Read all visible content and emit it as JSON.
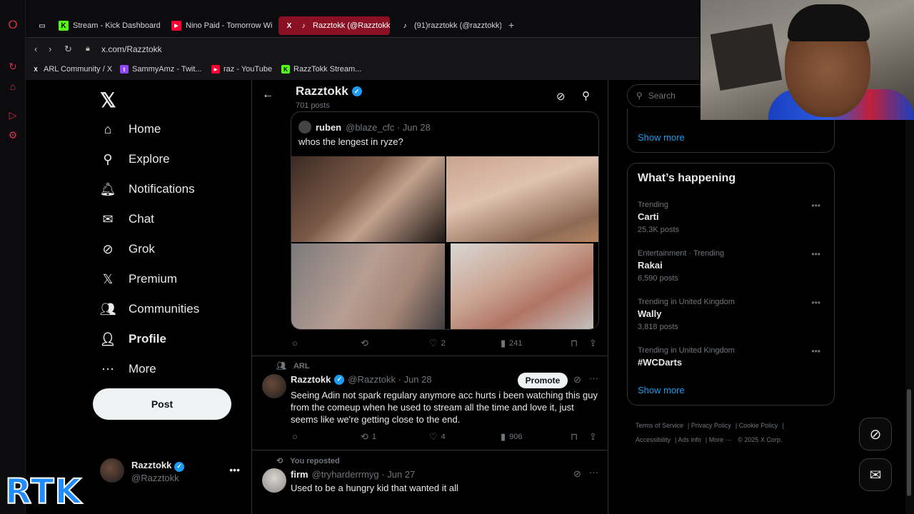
{
  "browser": {
    "tabs": [
      {
        "label": "Stream - Kick Dashboard",
        "fav": "K",
        "fav_color": "#53fc18",
        "active": false
      },
      {
        "label": "Nino Paid - Tomorrow Wi",
        "fav": "▶",
        "fav_color": "#ff0033",
        "active": false
      },
      {
        "label": "Razztokk (@Razztokk",
        "fav": "X",
        "fav_color": "#000000",
        "active": true
      },
      {
        "label": "(91)razztokk (@razztokk)",
        "fav": "♪",
        "fav_color": "#000000",
        "active": false
      }
    ],
    "url": "x.com/Razztokk",
    "bookmarks": [
      {
        "label": "ARL Community / X",
        "fav": "X",
        "fav_color": "#000000"
      },
      {
        "label": "SammyAmz - Twit...",
        "fav": "t",
        "fav_color": "#9146ff"
      },
      {
        "label": "raz - YouTube",
        "fav": "▶",
        "fav_color": "#ff0033"
      },
      {
        "label": "RazzTokk Stream...",
        "fav": "K",
        "fav_color": "#53fc18"
      }
    ]
  },
  "nav": {
    "items": [
      {
        "label": "Home",
        "icon": "home-icon"
      },
      {
        "label": "Explore",
        "icon": "search-icon"
      },
      {
        "label": "Notifications",
        "icon": "bell-icon"
      },
      {
        "label": "Chat",
        "icon": "mail-icon"
      },
      {
        "label": "Grok",
        "icon": "grok-icon"
      },
      {
        "label": "Premium",
        "icon": "x-icon"
      },
      {
        "label": "Communities",
        "icon": "communities-icon"
      },
      {
        "label": "Profile",
        "icon": "person-icon"
      },
      {
        "label": "More",
        "icon": "more-circle-icon"
      }
    ],
    "post_label": "Post",
    "account": {
      "name": "Razztokk",
      "handle": "@Razztokk"
    }
  },
  "overlay_logo": "RTK",
  "profile_header": {
    "name": "Razztokk",
    "posts": "701 posts"
  },
  "quote_tweet": {
    "name": "ruben",
    "meta": "@blaze_cfc · Jun 28",
    "text": "whos the lengest in ryze?"
  },
  "quote_actions": {
    "likes": "2",
    "views": "241"
  },
  "tweet1": {
    "community": "ARL",
    "name": "Razztokk",
    "meta": "@Razztokk · Jun 28",
    "promote": "Promote",
    "text": "Seeing Adin not spark regulary anymore acc hurts i been watching this guy from the comeup when he used to stream all the time and love it, just seems like we're getting close to the end.",
    "reposts": "1",
    "likes": "4",
    "views": "906"
  },
  "tweet2": {
    "reposted": "You reposted",
    "name": "firm",
    "meta": "@tryharderrmyg · Jun 27",
    "text": "Used to be a hungry kid that wanted it all"
  },
  "right": {
    "search_placeholder": "Search",
    "show_more_1": "Show more",
    "whats_happening": "What’s happening",
    "trends": [
      {
        "context": "Trending",
        "name": "Carti",
        "count": "25.3K posts"
      },
      {
        "context": "Entertainment · Trending",
        "name": "Rakai",
        "count": "6,590 posts"
      },
      {
        "context": "Trending in United Kingdom",
        "name": "Wally",
        "count": "3,818 posts"
      },
      {
        "context": "Trending in United Kingdom",
        "name": "#WCDarts",
        "count": ""
      }
    ],
    "show_more_2": "Show more",
    "footer": [
      "Terms of Service",
      "Privacy Policy",
      "Cookie Policy",
      "Accessibility",
      "Ads info",
      "More ···",
      "© 2025 X Corp."
    ]
  },
  "colors": {
    "accent": "#1d9bf0",
    "opera_red": "#d1324a",
    "active_tab": "#8a1124"
  }
}
